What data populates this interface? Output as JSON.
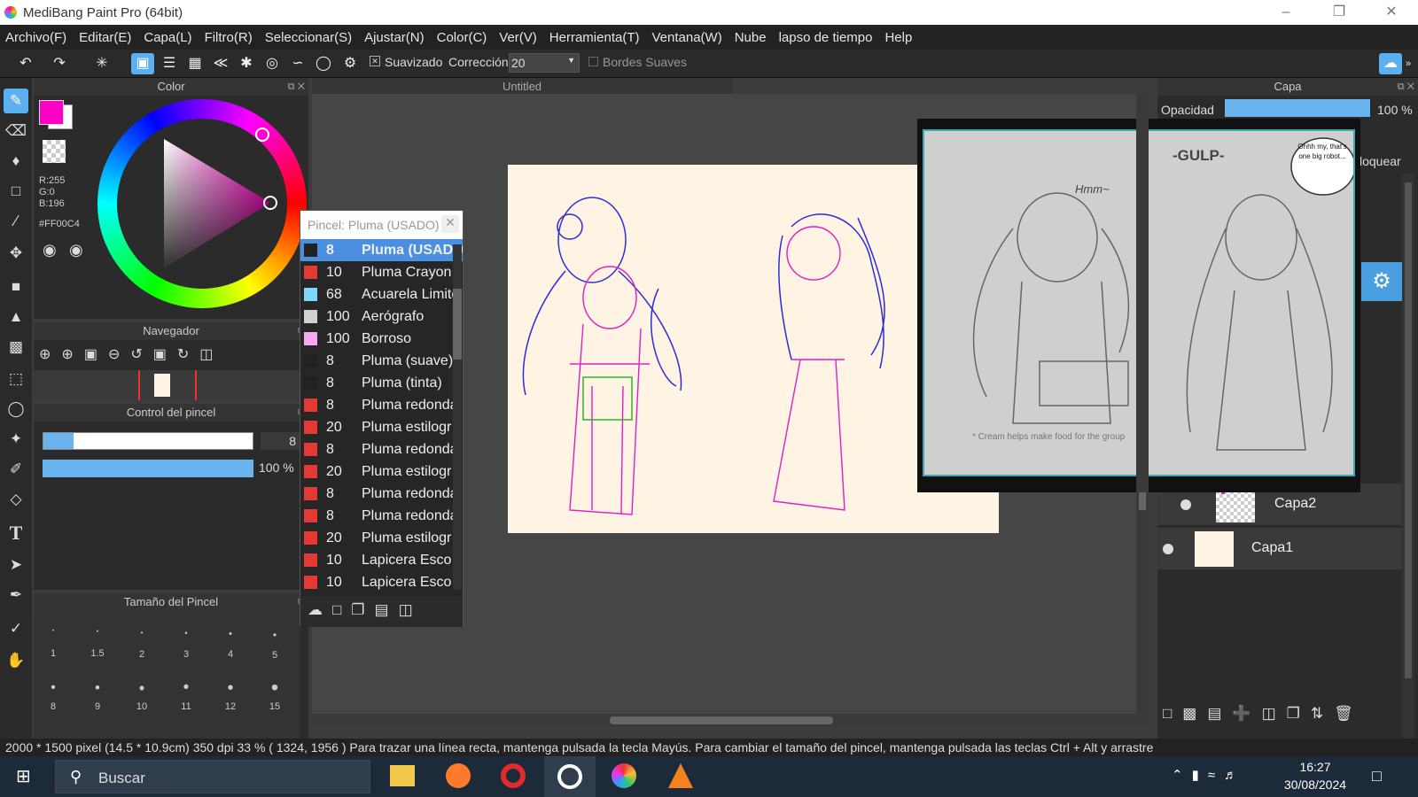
{
  "app": {
    "title": "MediBang Paint Pro (64bit)"
  },
  "menu": [
    "Archivo(F)",
    "Editar(E)",
    "Capa(L)",
    "Filtro(R)",
    "Seleccionar(S)",
    "Ajustar(N)",
    "Color(C)",
    "Ver(V)",
    "Herramienta(T)",
    "Ventana(W)",
    "Nube",
    "lapso de tiempo",
    "Help"
  ],
  "toolbar": {
    "smoothing_label": "Suavizado",
    "correction_label": "Corrección",
    "correction_value": "20",
    "soft_edges_label": "Bordes Suaves"
  },
  "color_panel": {
    "title": "Color",
    "r": "R:255",
    "g": "G:0",
    "b": "B:196",
    "hex": "#FF00C4",
    "fg": "#FF00C4"
  },
  "navigator": {
    "title": "Navegador"
  },
  "brush_control": {
    "title": "Control del pincel",
    "size_value": "8",
    "opacity_value": "100 %"
  },
  "brush_size": {
    "title": "Tamaño del Pincel",
    "row1": [
      "1",
      "1.5",
      "2",
      "3",
      "4",
      "5"
    ],
    "row2": [
      "8",
      "9",
      "10",
      "11",
      "12",
      "15"
    ]
  },
  "document": {
    "tab": "Untitled"
  },
  "brush_popup": {
    "title": "Pincel: Pluma (USADO)",
    "items": [
      {
        "size": "8",
        "name": "Pluma (USADO)",
        "color": "#222222"
      },
      {
        "size": "10",
        "name": "Pluma Crayon",
        "color": "#e53935"
      },
      {
        "size": "68",
        "name": "Acuarela Limite",
        "color": "#7fd7f7"
      },
      {
        "size": "100",
        "name": "Aerógrafo",
        "color": "#d0d0d0"
      },
      {
        "size": "100",
        "name": "Borroso",
        "color": "#f7a8f2"
      },
      {
        "size": "8",
        "name": "Pluma (suave)",
        "color": "#222222"
      },
      {
        "size": "8",
        "name": "Pluma (tinta)",
        "color": "#222222"
      },
      {
        "size": "8",
        "name": "Pluma redonda",
        "color": "#e53935"
      },
      {
        "size": "20",
        "name": "Pluma estilogr",
        "color": "#e53935"
      },
      {
        "size": "8",
        "name": "Pluma redonda",
        "color": "#e53935"
      },
      {
        "size": "20",
        "name": "Pluma estilogr",
        "color": "#e53935"
      },
      {
        "size": "8",
        "name": "Pluma redonda",
        "color": "#e53935"
      },
      {
        "size": "8",
        "name": "Pluma redonda",
        "color": "#e53935"
      },
      {
        "size": "20",
        "name": "Pluma estilogr",
        "color": "#e53935"
      },
      {
        "size": "10",
        "name": "Lapicera Esco",
        "color": "#e53935"
      },
      {
        "size": "10",
        "name": "Lapicera Esco",
        "color": "#e53935"
      }
    ]
  },
  "layer_panel": {
    "title": "Capa",
    "opacity_label": "Opacidad",
    "opacity_value": "100 %",
    "lock_label": "loquear",
    "layers": [
      {
        "name": "Capa2"
      },
      {
        "name": "Capa1"
      }
    ]
  },
  "reference_image": {
    "sfx": "-GULP-",
    "speech": "Ohhh my, that's one big robot...",
    "hums": "Hmm~",
    "caption": "* Cream helps make food for the group"
  },
  "status": {
    "text": "2000 * 1500 pixel   (14.5 * 10.9cm)   350 dpi   33 %   ( 1324, 1956 )   Para trazar una línea recta, mantenga pulsada la tecla Mayús. Para cambiar el tamaño del pincel, mantenga pulsada las teclas Ctrl + Alt y arrastre"
  },
  "taskbar": {
    "search": "Buscar",
    "time": "16:27",
    "date": "30/08/2024"
  }
}
